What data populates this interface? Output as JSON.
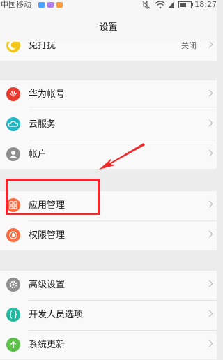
{
  "status_bar": {
    "carrier": "中国移动",
    "time": "18:27"
  },
  "header": {
    "title": "设置"
  },
  "groups": [
    {
      "items": [
        {
          "label": "免打扰",
          "value": "关闭",
          "icon": "moon-icon",
          "color": "#f5c518"
        }
      ]
    },
    {
      "items": [
        {
          "label": "华为帐号",
          "icon": "huawei-icon",
          "color": "#e83a2f"
        },
        {
          "label": "云服务",
          "icon": "cloud-icon",
          "color": "#22b7c4"
        },
        {
          "label": "帐户",
          "icon": "user-icon",
          "color": "#8f8f8f"
        }
      ]
    },
    {
      "items": [
        {
          "label": "应用管理",
          "icon": "apps-grid-icon",
          "color": "#ff6a3d"
        },
        {
          "label": "权限管理",
          "icon": "lock-icon",
          "color": "#ff6a3d"
        }
      ]
    },
    {
      "items": [
        {
          "label": "高级设置",
          "icon": "gear-icon",
          "color": "#8f8f8f"
        },
        {
          "label": "开发人员选项",
          "icon": "braces-icon",
          "color": "#23b9a0"
        },
        {
          "label": "系统更新",
          "icon": "upload-arrow-icon",
          "color": "#5cc04b"
        }
      ]
    }
  ],
  "annotation": {
    "highlight_color": "#f02a2a"
  }
}
